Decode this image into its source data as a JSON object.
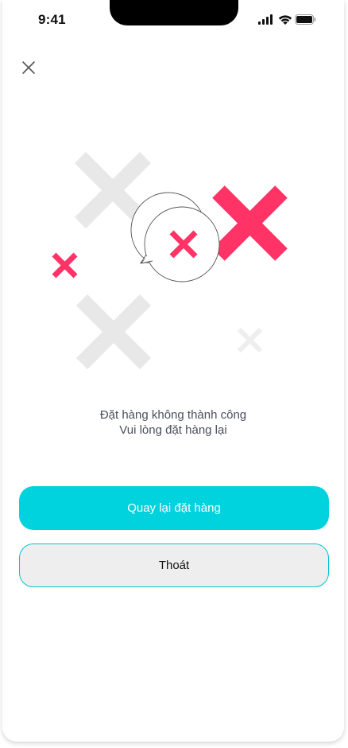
{
  "status_bar": {
    "time": "9:41",
    "icons": [
      "signal-icon",
      "wifi-icon",
      "battery-icon"
    ]
  },
  "header": {
    "close_icon": "close-icon"
  },
  "illustration": {
    "name": "order-failed-illustration",
    "accent_color": "#ff3366",
    "muted_color": "#e8e8e8"
  },
  "message": {
    "line1": "Đặt hàng không thành công",
    "line2": "Vui lòng đặt hàng lại"
  },
  "actions": {
    "retry_label": "Quay lại đặt hàng",
    "exit_label": "Thoát"
  },
  "colors": {
    "primary": "#00d2de",
    "secondary_bg": "#eeeeee",
    "text": "#4a4f5c"
  }
}
